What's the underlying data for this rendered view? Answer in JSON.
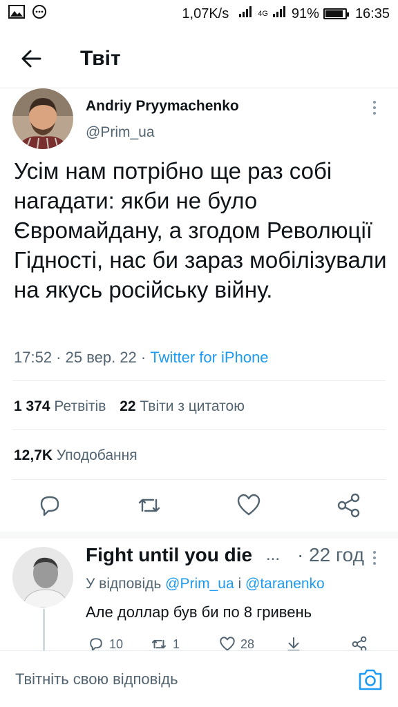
{
  "status_bar": {
    "network_speed": "1,07K/s",
    "battery_percent": "91%",
    "battery_level": 0.91,
    "time": "16:35",
    "network_type": "4G",
    "icons": [
      "image-icon",
      "chat-icon",
      "signal-icon",
      "battery-icon"
    ]
  },
  "header": {
    "title": "Твіт"
  },
  "tweet": {
    "author_name": "Andriy Pryymachenko",
    "author_handle": "@Prim_ua",
    "text": "Усім нам потрібно ще раз собі нагадати: якби не було Євромайдану, а згодом Революції Гідності, нас би зараз мобілізували на якусь російську війну.",
    "timestamp": "17:52 · 25 вер. 22 · ",
    "source": "Twitter for iPhone",
    "retweets_count": "1 374",
    "retweets_label": "Ретвітів",
    "quotes_count": "22",
    "quotes_label": "Твіти з цитатою",
    "likes_count": "12,7K",
    "likes_label": "Уподобання"
  },
  "reply": {
    "author_name": "Fight until you die",
    "ellipsis": "...",
    "time": "· 22 год",
    "reply_to_prefix": "У відповідь ",
    "reply_to_user1": "@Prim_ua",
    "reply_to_joiner": " і ",
    "reply_to_user2": "@taranenko",
    "text": "Але доллар був би по 8 гривень",
    "reply_count": "10",
    "retweet_count": "1",
    "like_count": "28"
  },
  "compose": {
    "placeholder": "Твітніть свою відповідь"
  },
  "colors": {
    "accent": "#1d9bf0",
    "secondary_text": "#536471",
    "divider": "#e6ecf0"
  }
}
